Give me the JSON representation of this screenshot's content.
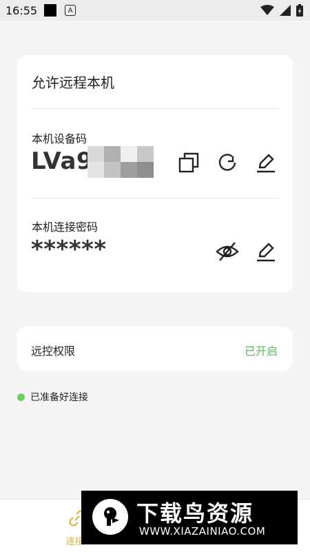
{
  "status_bar": {
    "time": "16:55"
  },
  "device_card": {
    "title": "允许远程本机",
    "device_code_label": "本机设备码",
    "device_code_value": "LVa9",
    "password_label": "本机连接密码",
    "password_value": "******"
  },
  "permission_card": {
    "label": "远控权限",
    "value": "已开启"
  },
  "ready_status": "已准备好连接",
  "bottom_nav": {
    "item_label": "连接"
  },
  "watermark": {
    "title": "下载鸟资源",
    "url": "WWW.XIAZAINIAO.COM"
  },
  "colors": {
    "accent_green": "#5cb85c",
    "status_dot": "#6fcf63",
    "nav_accent": "#e3b23c"
  }
}
